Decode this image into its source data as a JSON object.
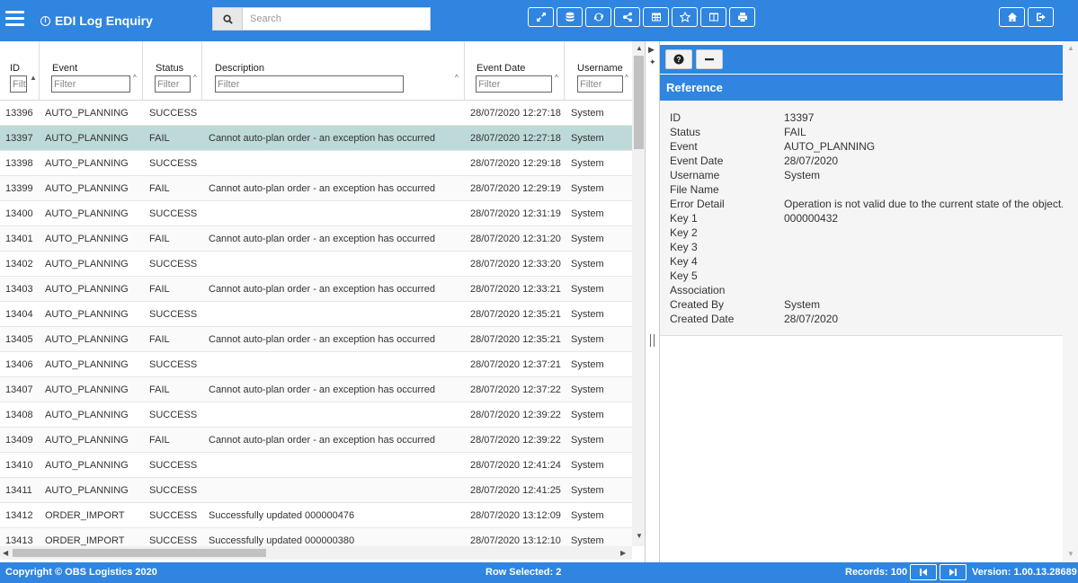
{
  "header": {
    "title": "EDI Log Enquiry",
    "search_placeholder": "Search"
  },
  "toolbar": {
    "center_icons": [
      "expand-icon",
      "database-icon",
      "refresh-icon",
      "share-icon",
      "table-icon",
      "star-icon",
      "columns-icon",
      "print-icon"
    ],
    "right_icons": [
      "home-icon",
      "logout-icon"
    ]
  },
  "grid": {
    "columns": [
      {
        "label": "ID",
        "filter_placeholder": "Filter"
      },
      {
        "label": "Event",
        "filter_placeholder": "Filter"
      },
      {
        "label": "Status",
        "filter_placeholder": "Filter"
      },
      {
        "label": "Description",
        "filter_placeholder": "Filter"
      },
      {
        "label": "Event Date",
        "filter_placeholder": "Filter"
      },
      {
        "label": "Username",
        "filter_placeholder": "Filter"
      }
    ],
    "rows": [
      {
        "id": "13396",
        "event": "AUTO_PLANNING",
        "status": "SUCCESS",
        "description": "",
        "date": "28/07/2020 12:27:18",
        "user": "System"
      },
      {
        "id": "13397",
        "event": "AUTO_PLANNING",
        "status": "FAIL",
        "description": "Cannot auto-plan order - an exception has occurred",
        "date": "28/07/2020 12:27:18",
        "user": "System",
        "selected": true
      },
      {
        "id": "13398",
        "event": "AUTO_PLANNING",
        "status": "SUCCESS",
        "description": "",
        "date": "28/07/2020 12:29:18",
        "user": "System"
      },
      {
        "id": "13399",
        "event": "AUTO_PLANNING",
        "status": "FAIL",
        "description": "Cannot auto-plan order - an exception has occurred",
        "date": "28/07/2020 12:29:19",
        "user": "System"
      },
      {
        "id": "13400",
        "event": "AUTO_PLANNING",
        "status": "SUCCESS",
        "description": "",
        "date": "28/07/2020 12:31:19",
        "user": "System"
      },
      {
        "id": "13401",
        "event": "AUTO_PLANNING",
        "status": "FAIL",
        "description": "Cannot auto-plan order - an exception has occurred",
        "date": "28/07/2020 12:31:20",
        "user": "System"
      },
      {
        "id": "13402",
        "event": "AUTO_PLANNING",
        "status": "SUCCESS",
        "description": "",
        "date": "28/07/2020 12:33:20",
        "user": "System"
      },
      {
        "id": "13403",
        "event": "AUTO_PLANNING",
        "status": "FAIL",
        "description": "Cannot auto-plan order - an exception has occurred",
        "date": "28/07/2020 12:33:21",
        "user": "System"
      },
      {
        "id": "13404",
        "event": "AUTO_PLANNING",
        "status": "SUCCESS",
        "description": "",
        "date": "28/07/2020 12:35:21",
        "user": "System"
      },
      {
        "id": "13405",
        "event": "AUTO_PLANNING",
        "status": "FAIL",
        "description": "Cannot auto-plan order - an exception has occurred",
        "date": "28/07/2020 12:35:21",
        "user": "System"
      },
      {
        "id": "13406",
        "event": "AUTO_PLANNING",
        "status": "SUCCESS",
        "description": "",
        "date": "28/07/2020 12:37:21",
        "user": "System"
      },
      {
        "id": "13407",
        "event": "AUTO_PLANNING",
        "status": "FAIL",
        "description": "Cannot auto-plan order - an exception has occurred",
        "date": "28/07/2020 12:37:22",
        "user": "System"
      },
      {
        "id": "13408",
        "event": "AUTO_PLANNING",
        "status": "SUCCESS",
        "description": "",
        "date": "28/07/2020 12:39:22",
        "user": "System"
      },
      {
        "id": "13409",
        "event": "AUTO_PLANNING",
        "status": "FAIL",
        "description": "Cannot auto-plan order - an exception has occurred",
        "date": "28/07/2020 12:39:22",
        "user": "System"
      },
      {
        "id": "13410",
        "event": "AUTO_PLANNING",
        "status": "SUCCESS",
        "description": "",
        "date": "28/07/2020 12:41:24",
        "user": "System"
      },
      {
        "id": "13411",
        "event": "AUTO_PLANNING",
        "status": "SUCCESS",
        "description": "",
        "date": "28/07/2020 12:41:25",
        "user": "System"
      },
      {
        "id": "13412",
        "event": "ORDER_IMPORT",
        "status": "SUCCESS",
        "description": "Successfully updated 000000476",
        "date": "28/07/2020 13:12:09",
        "user": "System"
      },
      {
        "id": "13413",
        "event": "ORDER_IMPORT",
        "status": "SUCCESS",
        "description": "Successfully updated 000000380",
        "date": "28/07/2020 13:12:10",
        "user": "System"
      }
    ]
  },
  "detail": {
    "title": "Reference",
    "fields": [
      {
        "label": "ID",
        "value": "13397"
      },
      {
        "label": "Status",
        "value": "FAIL"
      },
      {
        "label": "Event",
        "value": "AUTO_PLANNING"
      },
      {
        "label": "Event Date",
        "value": "28/07/2020"
      },
      {
        "label": "Username",
        "value": "System"
      },
      {
        "label": "File Name",
        "value": ""
      },
      {
        "label": "Error Detail",
        "value": "Operation is not valid due to the current state of the object."
      },
      {
        "label": "Key 1",
        "value": "000000432"
      },
      {
        "label": "Key 2",
        "value": ""
      },
      {
        "label": "Key 3",
        "value": ""
      },
      {
        "label": "Key 4",
        "value": ""
      },
      {
        "label": "Key 5",
        "value": ""
      },
      {
        "label": "Association",
        "value": ""
      },
      {
        "label": "Created By",
        "value": "System"
      },
      {
        "label": "Created Date",
        "value": "28/07/2020"
      }
    ]
  },
  "footer": {
    "copyright": "Copyright © OBS Logistics 2020",
    "row_selected": "Row Selected: 2",
    "records": "Records: 100",
    "version": "Version: 1.00.13.28689"
  }
}
